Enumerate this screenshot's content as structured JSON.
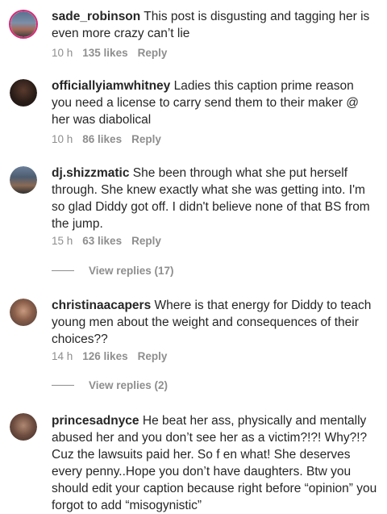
{
  "comments": [
    {
      "username": "sade_robinson",
      "text": "This post is disgusting and tagging her is even more crazy can’t lie",
      "time": "10 h",
      "likes": "135 likes",
      "reply": "Reply"
    },
    {
      "username": "officiallyiamwhitney",
      "text": "Ladies this caption prime reason you need a license to carry send them to their maker @ her was diabolical",
      "time": "10 h",
      "likes": "86 likes",
      "reply": "Reply"
    },
    {
      "username": "dj.shizzmatic",
      "text": "She been through what she put herself through. She knew exactly what she was getting into. I'm so glad Diddy got off. I didn't believe none of that BS from the jump.",
      "time": "15 h",
      "likes": "63 likes",
      "reply": "Reply",
      "view_replies": "View replies (17)"
    },
    {
      "username": "christinaacapers",
      "text": "Where is that energy for Diddy to teach young men about the weight and consequences of their choices??",
      "time": "14 h",
      "likes": "126 likes",
      "reply": "Reply",
      "view_replies": "View replies (2)"
    },
    {
      "username": "princesadnyce",
      "text": "He beat her ass, physically and mentally abused her and you don’t see her as a victim?!?! Why?!? Cuz the lawsuits paid her. So f en what! She deserves every penny..Hope you don’t have daughters. Btw you should edit your caption because right before “opinion” you forgot to add “misogynistic”"
    }
  ],
  "colors": {
    "text": "#262626",
    "secondary": "#8e8e8e",
    "story_ring": "#d62976"
  }
}
